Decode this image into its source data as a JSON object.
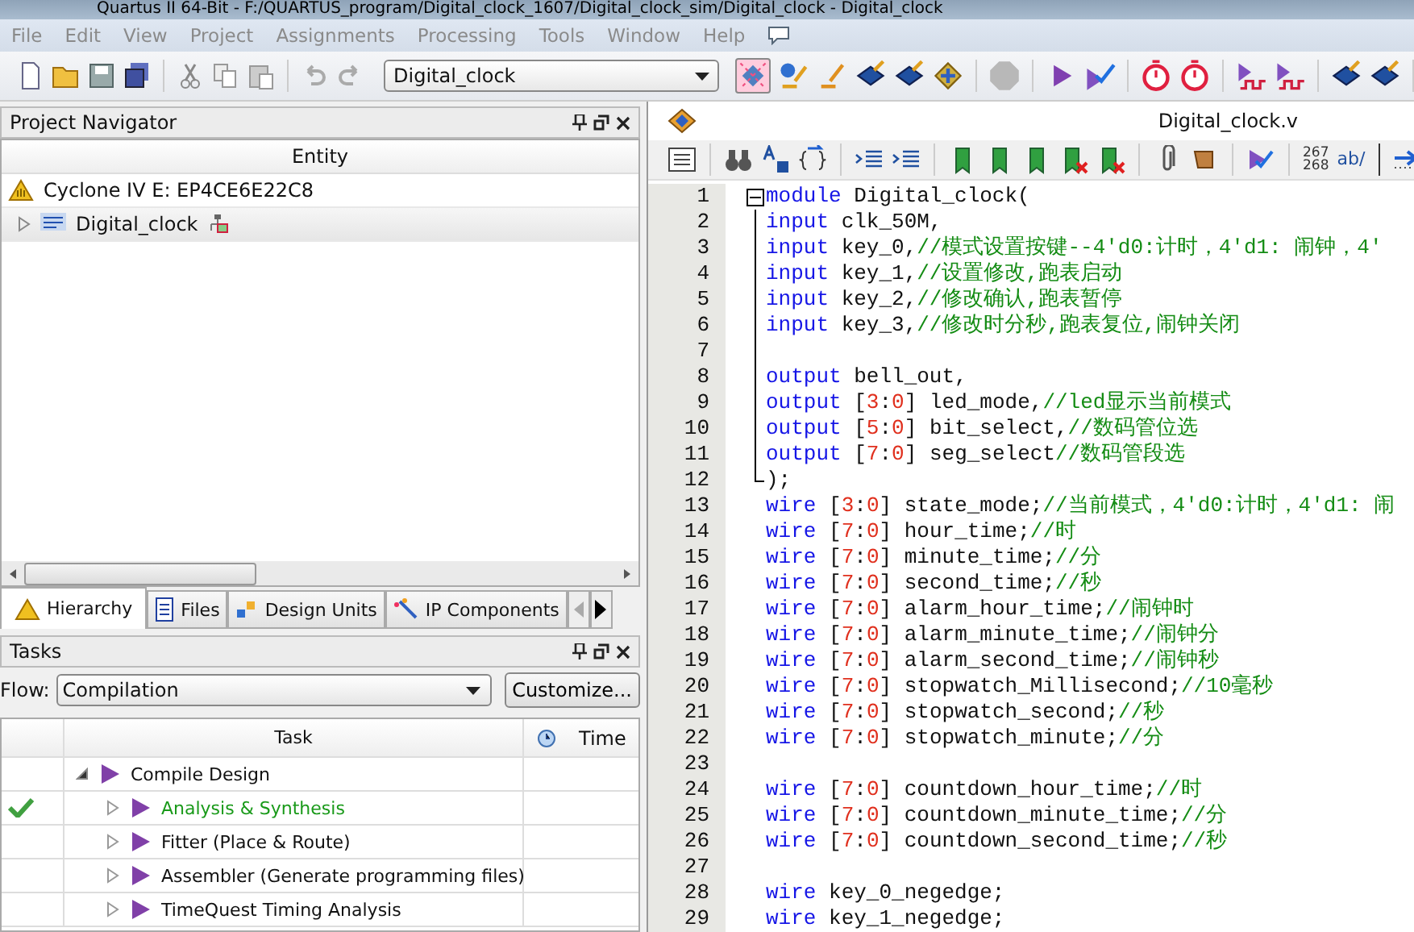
{
  "window": {
    "title": "Quartus II 64-Bit - F:/QUARTUS_program/Digital_clock_1607/Digital_clock_sim/Digital_clock - Digital_clock"
  },
  "menu": [
    "File",
    "Edit",
    "View",
    "Project",
    "Assignments",
    "Processing",
    "Tools",
    "Window",
    "Help"
  ],
  "toolbar": {
    "revision": "Digital_clock"
  },
  "project_navigator": {
    "title": "Project Navigator",
    "column": "Entity",
    "items": [
      {
        "kind": "device",
        "label": "Cyclone IV E: EP4CE6E22C8",
        "selected": false
      },
      {
        "kind": "entity",
        "label": "Digital_clock",
        "selected": true,
        "expanded": false
      }
    ],
    "tabs": [
      {
        "label": "Hierarchy",
        "selected": true
      },
      {
        "label": "Files",
        "selected": false
      },
      {
        "label": "Design Units",
        "selected": false
      },
      {
        "label": "IP Components",
        "selected": false
      }
    ]
  },
  "tasks": {
    "title": "Tasks",
    "flow_label": "Flow:",
    "flow": "Compilation",
    "customize": "Customize...",
    "columns": [
      "Task",
      "Time"
    ],
    "rows": [
      {
        "label": "Compile Design",
        "done": false,
        "expanded": true,
        "children": [
          {
            "label": "Analysis & Synthesis",
            "done": true,
            "expanded": false
          },
          {
            "label": "Fitter (Place & Route)",
            "done": false,
            "expanded": false
          },
          {
            "label": "Assembler (Generate programming files)",
            "done": false,
            "expanded": false
          },
          {
            "label": "TimeQuest Timing Analysis",
            "done": false,
            "expanded": false
          }
        ]
      }
    ]
  },
  "editor": {
    "file": "Digital_clock.v",
    "toolbar_texts": {
      "line_numbers": [
        "267",
        "268"
      ],
      "wrap": "ab/"
    },
    "lines": [
      {
        "number": "1",
        "kind": "fold-start",
        "tokens": [
          {
            "kind": "kw",
            "text": "module"
          },
          {
            "kind": "id",
            "text": " Digital_clock("
          }
        ]
      },
      {
        "number": "2",
        "kind": "fold-body",
        "tokens": [
          {
            "kind": "kw",
            "text": "input"
          },
          {
            "kind": "id",
            "text": " clk_50M,"
          }
        ]
      },
      {
        "number": "3",
        "kind": "fold-body",
        "tokens": [
          {
            "kind": "kw",
            "text": "input"
          },
          {
            "kind": "id",
            "text": " key_0,"
          },
          {
            "kind": "cmt",
            "text": "//模式设置按键--4'd0:计时，4'd1: 闹钟，4'"
          }
        ]
      },
      {
        "number": "4",
        "kind": "fold-body",
        "tokens": [
          {
            "kind": "kw",
            "text": "input"
          },
          {
            "kind": "id",
            "text": " key_1,"
          },
          {
            "kind": "cmt",
            "text": "//设置修改,跑表启动"
          }
        ]
      },
      {
        "number": "5",
        "kind": "fold-body",
        "tokens": [
          {
            "kind": "kw",
            "text": "input"
          },
          {
            "kind": "id",
            "text": " key_2,"
          },
          {
            "kind": "cmt",
            "text": "//修改确认,跑表暂停"
          }
        ]
      },
      {
        "number": "6",
        "kind": "fold-body",
        "tokens": [
          {
            "kind": "kw",
            "text": "input"
          },
          {
            "kind": "id",
            "text": " key_3,"
          },
          {
            "kind": "cmt",
            "text": "//修改时分秒,跑表复位,闹钟关闭"
          }
        ]
      },
      {
        "number": "7",
        "kind": "fold-body"
      },
      {
        "number": "8",
        "kind": "fold-body",
        "tokens": [
          {
            "kind": "kw",
            "text": "output"
          },
          {
            "kind": "id",
            "text": " bell_out,"
          }
        ]
      },
      {
        "number": "9",
        "kind": "fold-body",
        "tokens": [
          {
            "kind": "kw",
            "text": "output"
          },
          {
            "kind": "id",
            "text": " ["
          },
          {
            "kind": "num",
            "text": "3"
          },
          {
            "kind": "id",
            "text": ":"
          },
          {
            "kind": "num",
            "text": "0"
          },
          {
            "kind": "id",
            "text": "] led_mode,"
          },
          {
            "kind": "cmt",
            "text": "//led显示当前模式"
          }
        ]
      },
      {
        "number": "10",
        "kind": "fold-body",
        "tokens": [
          {
            "kind": "kw",
            "text": "output"
          },
          {
            "kind": "id",
            "text": " ["
          },
          {
            "kind": "num",
            "text": "5"
          },
          {
            "kind": "id",
            "text": ":"
          },
          {
            "kind": "num",
            "text": "0"
          },
          {
            "kind": "id",
            "text": "] bit_select,"
          },
          {
            "kind": "cmt",
            "text": "//数码管位选"
          }
        ]
      },
      {
        "number": "11",
        "kind": "fold-body",
        "tokens": [
          {
            "kind": "kw",
            "text": "output"
          },
          {
            "kind": "id",
            "text": " ["
          },
          {
            "kind": "num",
            "text": "7"
          },
          {
            "kind": "id",
            "text": ":"
          },
          {
            "kind": "num",
            "text": "0"
          },
          {
            "kind": "id",
            "text": "] seg_select"
          },
          {
            "kind": "cmt",
            "text": "//数码管段选"
          }
        ]
      },
      {
        "number": "12",
        "kind": "fold-end",
        "tokens": [
          {
            "kind": "id",
            "text": ");"
          }
        ]
      },
      {
        "number": "13",
        "tokens": [
          {
            "kind": "kw",
            "text": "wire"
          },
          {
            "kind": "id",
            "text": " ["
          },
          {
            "kind": "num",
            "text": "3"
          },
          {
            "kind": "id",
            "text": ":"
          },
          {
            "kind": "num",
            "text": "0"
          },
          {
            "kind": "id",
            "text": "] state_mode;"
          },
          {
            "kind": "cmt",
            "text": "//当前模式，4'd0:计时，4'd1: 闹"
          }
        ]
      },
      {
        "number": "14",
        "tokens": [
          {
            "kind": "kw",
            "text": "wire"
          },
          {
            "kind": "id",
            "text": " ["
          },
          {
            "kind": "num",
            "text": "7"
          },
          {
            "kind": "id",
            "text": ":"
          },
          {
            "kind": "num",
            "text": "0"
          },
          {
            "kind": "id",
            "text": "] hour_time;"
          },
          {
            "kind": "cmt",
            "text": "//时"
          }
        ]
      },
      {
        "number": "15",
        "tokens": [
          {
            "kind": "kw",
            "text": "wire"
          },
          {
            "kind": "id",
            "text": " ["
          },
          {
            "kind": "num",
            "text": "7"
          },
          {
            "kind": "id",
            "text": ":"
          },
          {
            "kind": "num",
            "text": "0"
          },
          {
            "kind": "id",
            "text": "] minute_time;"
          },
          {
            "kind": "cmt",
            "text": "//分"
          }
        ]
      },
      {
        "number": "16",
        "tokens": [
          {
            "kind": "kw",
            "text": "wire"
          },
          {
            "kind": "id",
            "text": " ["
          },
          {
            "kind": "num",
            "text": "7"
          },
          {
            "kind": "id",
            "text": ":"
          },
          {
            "kind": "num",
            "text": "0"
          },
          {
            "kind": "id",
            "text": "] second_time;"
          },
          {
            "kind": "cmt",
            "text": "//秒"
          }
        ]
      },
      {
        "number": "17",
        "tokens": [
          {
            "kind": "kw",
            "text": "wire"
          },
          {
            "kind": "id",
            "text": " ["
          },
          {
            "kind": "num",
            "text": "7"
          },
          {
            "kind": "id",
            "text": ":"
          },
          {
            "kind": "num",
            "text": "0"
          },
          {
            "kind": "id",
            "text": "] alarm_hour_time;"
          },
          {
            "kind": "cmt",
            "text": "//闹钟时"
          }
        ]
      },
      {
        "number": "18",
        "tokens": [
          {
            "kind": "kw",
            "text": "wire"
          },
          {
            "kind": "id",
            "text": " ["
          },
          {
            "kind": "num",
            "text": "7"
          },
          {
            "kind": "id",
            "text": ":"
          },
          {
            "kind": "num",
            "text": "0"
          },
          {
            "kind": "id",
            "text": "] alarm_minute_time;"
          },
          {
            "kind": "cmt",
            "text": "//闹钟分"
          }
        ]
      },
      {
        "number": "19",
        "tokens": [
          {
            "kind": "kw",
            "text": "wire"
          },
          {
            "kind": "id",
            "text": " ["
          },
          {
            "kind": "num",
            "text": "7"
          },
          {
            "kind": "id",
            "text": ":"
          },
          {
            "kind": "num",
            "text": "0"
          },
          {
            "kind": "id",
            "text": "] alarm_second_time;"
          },
          {
            "kind": "cmt",
            "text": "//闹钟秒"
          }
        ]
      },
      {
        "number": "20",
        "tokens": [
          {
            "kind": "kw",
            "text": "wire"
          },
          {
            "kind": "id",
            "text": " ["
          },
          {
            "kind": "num",
            "text": "7"
          },
          {
            "kind": "id",
            "text": ":"
          },
          {
            "kind": "num",
            "text": "0"
          },
          {
            "kind": "id",
            "text": "] stopwatch_Millisecond;"
          },
          {
            "kind": "cmt",
            "text": "//10毫秒"
          }
        ]
      },
      {
        "number": "21",
        "tokens": [
          {
            "kind": "kw",
            "text": "wire"
          },
          {
            "kind": "id",
            "text": " ["
          },
          {
            "kind": "num",
            "text": "7"
          },
          {
            "kind": "id",
            "text": ":"
          },
          {
            "kind": "num",
            "text": "0"
          },
          {
            "kind": "id",
            "text": "] stopwatch_second;"
          },
          {
            "kind": "cmt",
            "text": "//秒"
          }
        ]
      },
      {
        "number": "22",
        "tokens": [
          {
            "kind": "kw",
            "text": "wire"
          },
          {
            "kind": "id",
            "text": " ["
          },
          {
            "kind": "num",
            "text": "7"
          },
          {
            "kind": "id",
            "text": ":"
          },
          {
            "kind": "num",
            "text": "0"
          },
          {
            "kind": "id",
            "text": "] stopwatch_minute;"
          },
          {
            "kind": "cmt",
            "text": "//分"
          }
        ]
      },
      {
        "number": "23"
      },
      {
        "number": "24",
        "tokens": [
          {
            "kind": "kw",
            "text": "wire"
          },
          {
            "kind": "id",
            "text": " ["
          },
          {
            "kind": "num",
            "text": "7"
          },
          {
            "kind": "id",
            "text": ":"
          },
          {
            "kind": "num",
            "text": "0"
          },
          {
            "kind": "id",
            "text": "] countdown_hour_time;"
          },
          {
            "kind": "cmt",
            "text": "//时"
          }
        ]
      },
      {
        "number": "25",
        "tokens": [
          {
            "kind": "kw",
            "text": "wire"
          },
          {
            "kind": "id",
            "text": " ["
          },
          {
            "kind": "num",
            "text": "7"
          },
          {
            "kind": "id",
            "text": ":"
          },
          {
            "kind": "num",
            "text": "0"
          },
          {
            "kind": "id",
            "text": "] countdown_minute_time;"
          },
          {
            "kind": "cmt",
            "text": "//分"
          }
        ]
      },
      {
        "number": "26",
        "tokens": [
          {
            "kind": "kw",
            "text": "wire"
          },
          {
            "kind": "id",
            "text": " ["
          },
          {
            "kind": "num",
            "text": "7"
          },
          {
            "kind": "id",
            "text": ":"
          },
          {
            "kind": "num",
            "text": "0"
          },
          {
            "kind": "id",
            "text": "] countdown_second_time;"
          },
          {
            "kind": "cmt",
            "text": "//秒"
          }
        ]
      },
      {
        "number": "27"
      },
      {
        "number": "28",
        "tokens": [
          {
            "kind": "kw",
            "text": "wire"
          },
          {
            "kind": "id",
            "text": " key_0_negedge;"
          }
        ]
      },
      {
        "number": "29",
        "tokens": [
          {
            "kind": "kw",
            "text": "wire"
          },
          {
            "kind": "id",
            "text": " key_1_negedge;"
          }
        ]
      }
    ]
  }
}
